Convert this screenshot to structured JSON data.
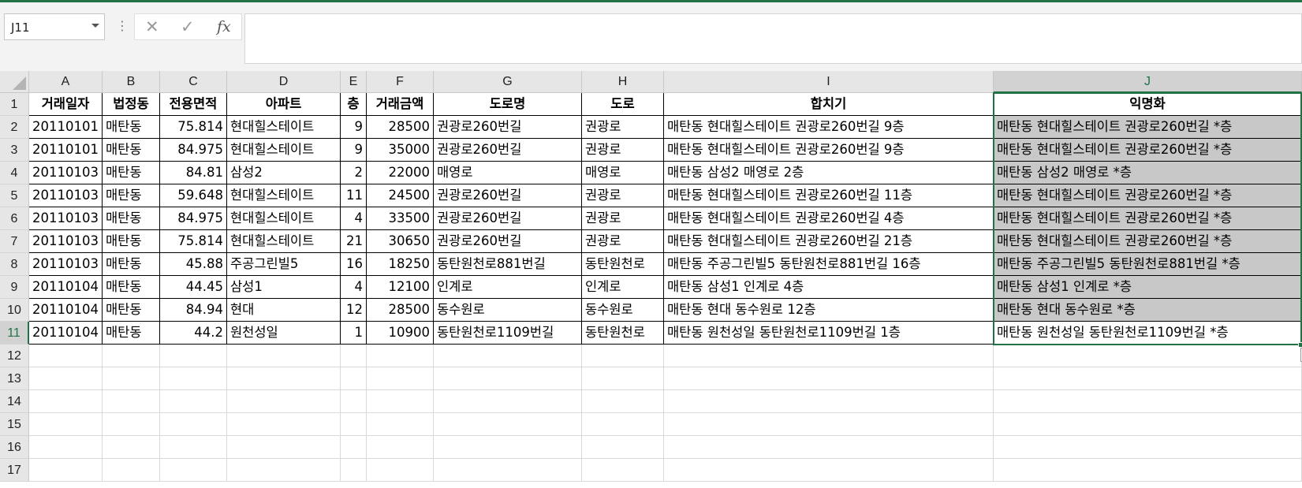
{
  "name_box": {
    "value": "J11"
  },
  "formula_bar": {
    "separator": "⋮",
    "cancel_icon": "✕",
    "enter_icon": "✓",
    "function_icon": "fx",
    "content": ""
  },
  "sheet": {
    "columns": [
      "A",
      "B",
      "C",
      "D",
      "E",
      "F",
      "G",
      "H",
      "I",
      "J"
    ],
    "selected_column": "J",
    "row_numbers": [
      "1",
      "2",
      "3",
      "4",
      "5",
      "6",
      "7",
      "8",
      "9",
      "10",
      "11",
      "12",
      "13",
      "14",
      "15",
      "16",
      "17"
    ],
    "selected_cell": "J11",
    "header_row": [
      "거래일자",
      "법정동",
      "전용면적",
      "아파트",
      "층",
      "거래금액",
      "도로명",
      "도로",
      "합치기",
      "익명화"
    ],
    "rows": [
      [
        "20110101",
        "매탄동",
        "75.814",
        "현대힐스테이트",
        "9",
        "28500",
        "권광로260번길",
        "권광로",
        "매탄동 현대힐스테이트 권광로260번길 9층",
        "매탄동 현대힐스테이트 권광로260번길 *층"
      ],
      [
        "20110101",
        "매탄동",
        "84.975",
        "현대힐스테이트",
        "9",
        "35000",
        "권광로260번길",
        "권광로",
        "매탄동 현대힐스테이트 권광로260번길 9층",
        "매탄동 현대힐스테이트 권광로260번길 *층"
      ],
      [
        "20110103",
        "매탄동",
        "84.81",
        "삼성2",
        "2",
        "22000",
        "매영로",
        "매영로",
        "매탄동 삼성2 매영로 2층",
        "매탄동 삼성2 매영로 *층"
      ],
      [
        "20110103",
        "매탄동",
        "59.648",
        "현대힐스테이트",
        "11",
        "24500",
        "권광로260번길",
        "권광로",
        "매탄동 현대힐스테이트 권광로260번길 11층",
        "매탄동 현대힐스테이트 권광로260번길 *층"
      ],
      [
        "20110103",
        "매탄동",
        "84.975",
        "현대힐스테이트",
        "4",
        "33500",
        "권광로260번길",
        "권광로",
        "매탄동 현대힐스테이트 권광로260번길 4층",
        "매탄동 현대힐스테이트 권광로260번길 *층"
      ],
      [
        "20110103",
        "매탄동",
        "75.814",
        "현대힐스테이트",
        "21",
        "30650",
        "권광로260번길",
        "권광로",
        "매탄동 현대힐스테이트 권광로260번길 21층",
        "매탄동 현대힐스테이트 권광로260번길 *층"
      ],
      [
        "20110103",
        "매탄동",
        "45.88",
        "주공그린빌5",
        "16",
        "18250",
        "동탄원천로881번길",
        "동탄원천로",
        "매탄동 주공그린빌5 동탄원천로881번길 16층",
        "매탄동 주공그린빌5 동탄원천로881번길 *층"
      ],
      [
        "20110104",
        "매탄동",
        "44.45",
        "삼성1",
        "4",
        "12100",
        "인계로",
        "인계로",
        "매탄동 삼성1 인계로 4층",
        "매탄동 삼성1 인계로 *층"
      ],
      [
        "20110104",
        "매탄동",
        "84.94",
        "현대",
        "12",
        "28500",
        "동수원로",
        "동수원로",
        "매탄동 현대 동수원로 12층",
        "매탄동 현대 동수원로 *층"
      ],
      [
        "20110104",
        "매탄동",
        "44.2",
        "원천성일",
        "1",
        "10900",
        "동탄원천로1109번길",
        "동탄원천로",
        "매탄동 원천성일 동탄원천로1109번길 1층",
        "매탄동 원천성일 동탄원천로1109번길 *층"
      ]
    ]
  },
  "colors": {
    "accent": "#217346",
    "selection_fill": "#c8c8c8",
    "header_bg": "#e6e6e6"
  }
}
